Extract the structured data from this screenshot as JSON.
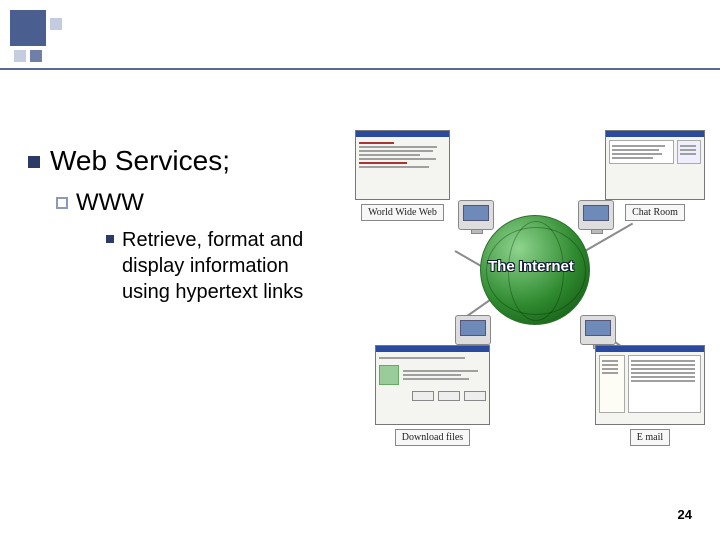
{
  "bullets": {
    "lvl1": "Web Services;",
    "lvl2": "WWW",
    "lvl3": "Retrieve, format and display information using hypertext links"
  },
  "diagram": {
    "center_label": "The Internet",
    "nodes": {
      "www": "World Wide Web",
      "chat": "Chat Room",
      "download": "Download files",
      "email": "E mail"
    }
  },
  "page_number": "24"
}
